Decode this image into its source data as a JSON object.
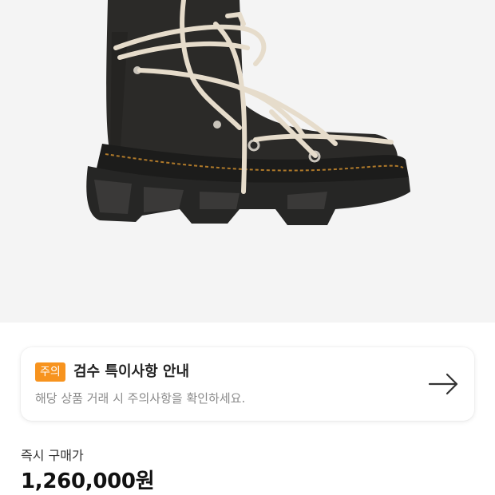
{
  "product": {
    "image_icon": "boot-image"
  },
  "notice": {
    "badge": "주의",
    "title": "검수 특이사항 안내",
    "description": "해당 상품 거래 시 주의사항을 확인하세요.",
    "arrow_icon": "arrow-right-icon",
    "badge_color": "#f7931e"
  },
  "price": {
    "label": "즉시 구매가",
    "value": "1,260,000원"
  }
}
